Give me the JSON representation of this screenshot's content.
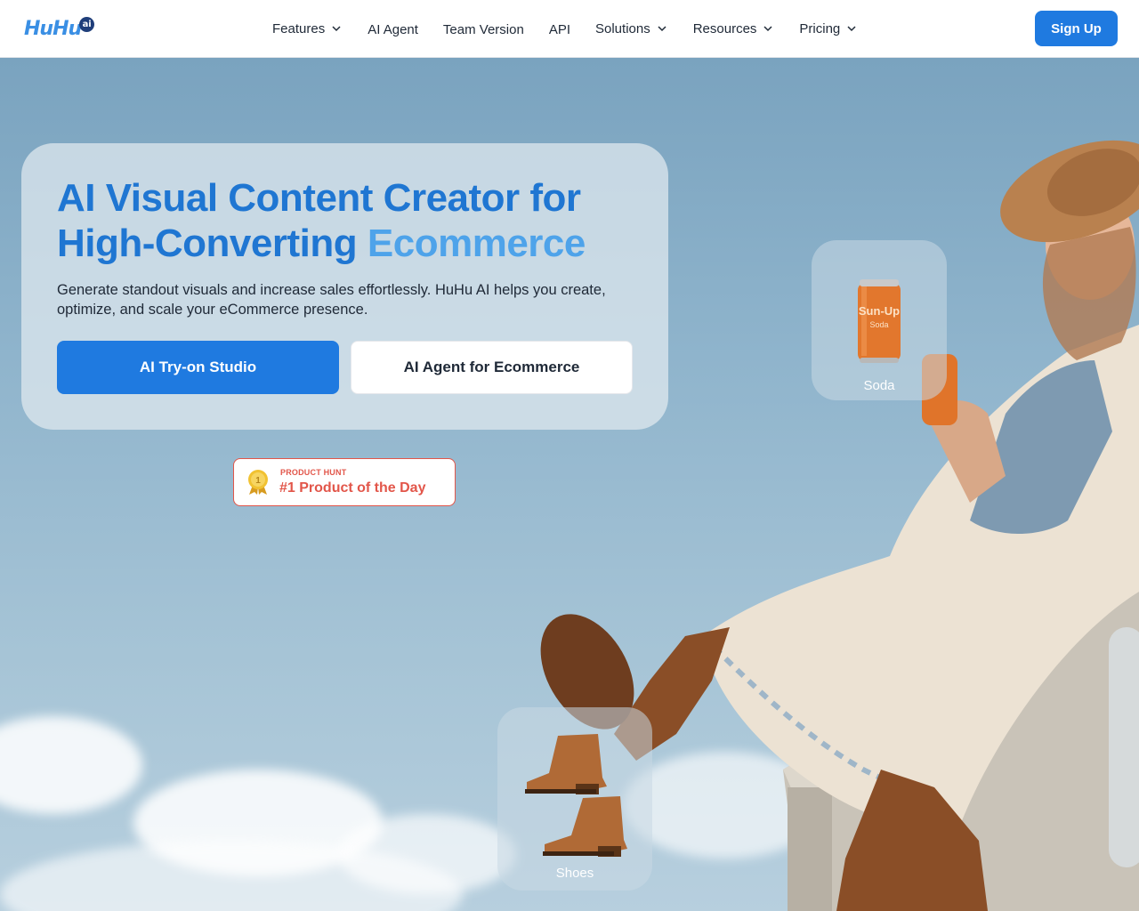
{
  "header": {
    "logo_text": "HuHu",
    "logo_badge": "ai",
    "nav": [
      {
        "label": "Features",
        "has_dropdown": true
      },
      {
        "label": "AI Agent",
        "has_dropdown": false
      },
      {
        "label": "Team Version",
        "has_dropdown": false
      },
      {
        "label": "API",
        "has_dropdown": false
      },
      {
        "label": "Solutions",
        "has_dropdown": true
      },
      {
        "label": "Resources",
        "has_dropdown": true
      },
      {
        "label": "Pricing",
        "has_dropdown": true
      }
    ],
    "signup_label": "Sign Up"
  },
  "hero": {
    "title_line1": "AI Visual Content Creator for",
    "title_line2_a": "High-Converting",
    "title_line2_b": "Ecommerce",
    "description": "Generate standout visuals and increase sales effortlessly. HuHu AI helps you create, optimize, and scale your eCommerce presence.",
    "primary_button": "AI Try-on Studio",
    "secondary_button": "AI Agent for Ecommerce",
    "badge": {
      "small": "PRODUCT HUNT",
      "big": "#1 Product of the Day",
      "medal_number": "1"
    }
  },
  "products": [
    {
      "label": "Soda",
      "can_text_1": "Sun-Up",
      "can_text_2": "Soda"
    },
    {
      "label": "Shoes"
    }
  ],
  "colors": {
    "brand_blue": "#1f7ae0",
    "accent_light_blue": "#4ea3ea",
    "badge_red": "#e2564a"
  }
}
